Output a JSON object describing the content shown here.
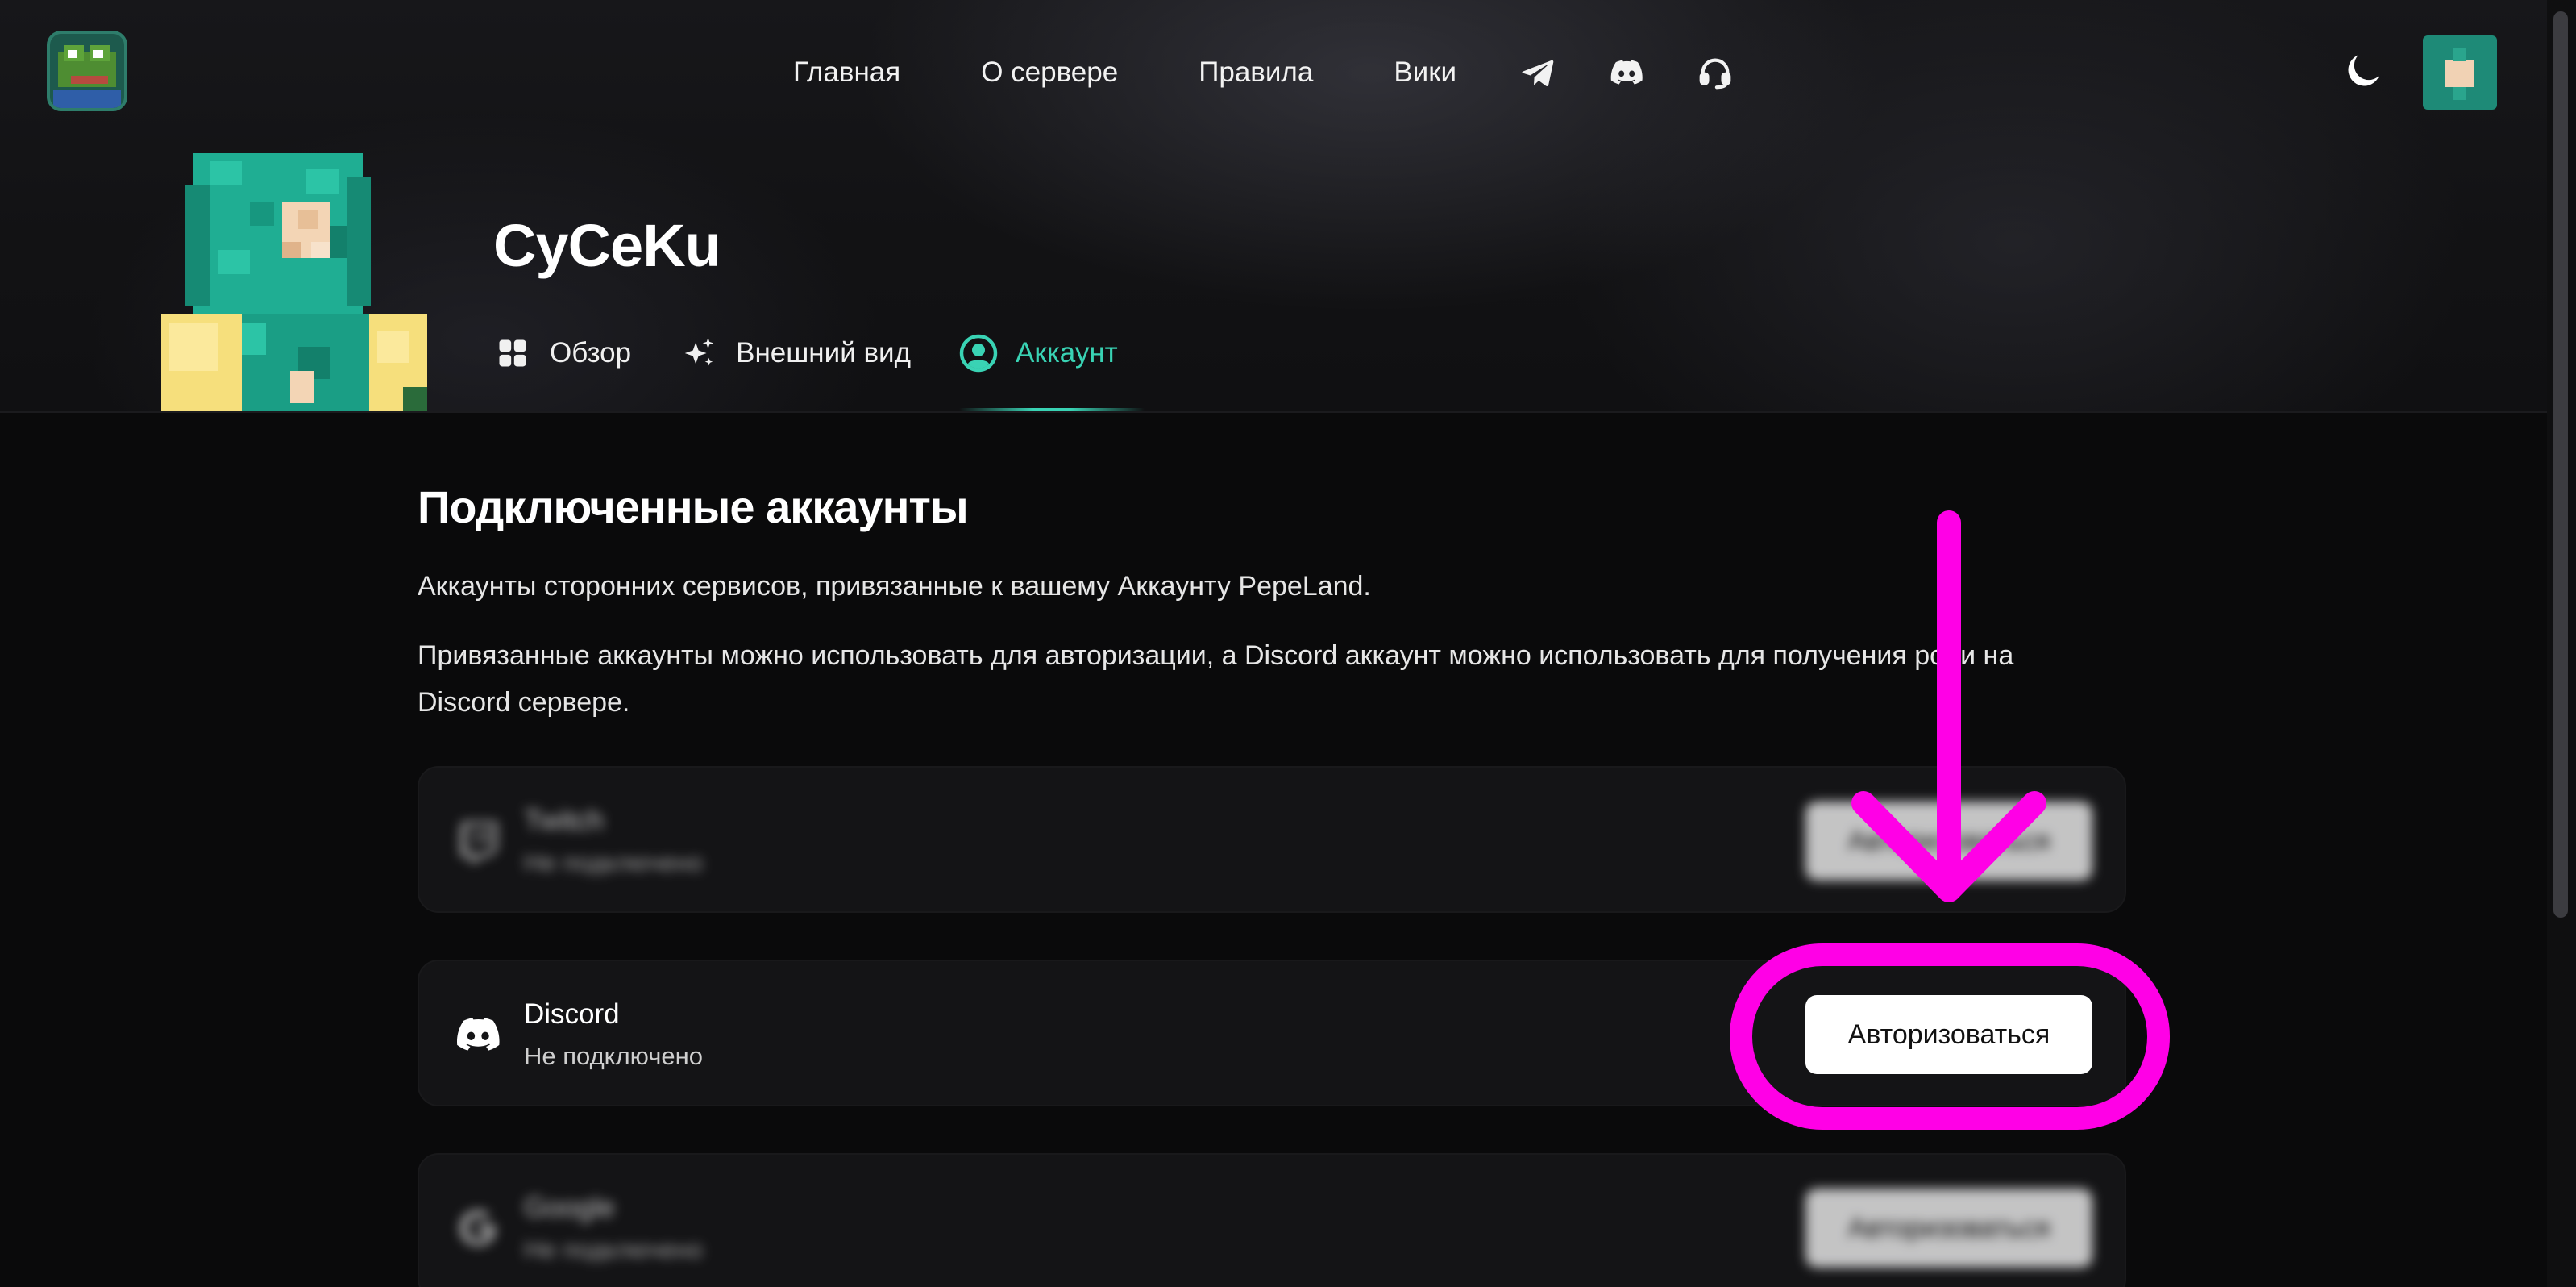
{
  "nav": {
    "links": [
      "Главная",
      "О сервере",
      "Правила",
      "Вики"
    ],
    "icons": [
      "telegram-icon",
      "discord-icon",
      "support-headset-icon"
    ]
  },
  "header": {
    "theme_icon": "moon-icon",
    "username": "CyCeKu"
  },
  "profile_tabs": [
    {
      "label": "Обзор",
      "icon": "grid-icon",
      "active": false
    },
    {
      "label": "Внешний вид",
      "icon": "sparkles-icon",
      "active": false
    },
    {
      "label": "Аккаунт",
      "icon": "user-circle-icon",
      "active": true
    }
  ],
  "section": {
    "title": "Подключенные аккаунты",
    "desc1": "Аккаунты сторонних сервисов, привязанные к вашему Аккаунту PepeLand.",
    "desc2": "Привязанные аккаунты можно использовать для авторизации, а Discord аккаунт можно использовать для получения роли на Discord сервере."
  },
  "accounts": [
    {
      "name": "Twitch",
      "status": "Не подключено",
      "button": "Авторизоваться",
      "icon": "twitch-icon",
      "blurred": true
    },
    {
      "name": "Discord",
      "status": "Не подключено",
      "button": "Авторизоваться",
      "icon": "discord-icon",
      "blurred": false
    },
    {
      "name": "Google",
      "status": "Не подключено",
      "button": "Авторизоваться",
      "icon": "google-icon",
      "blurred": true
    }
  ],
  "colors": {
    "accent": "#39d3b4",
    "annotation": "#ff00e6",
    "background": "#0a0a0b",
    "card": "#141416"
  }
}
